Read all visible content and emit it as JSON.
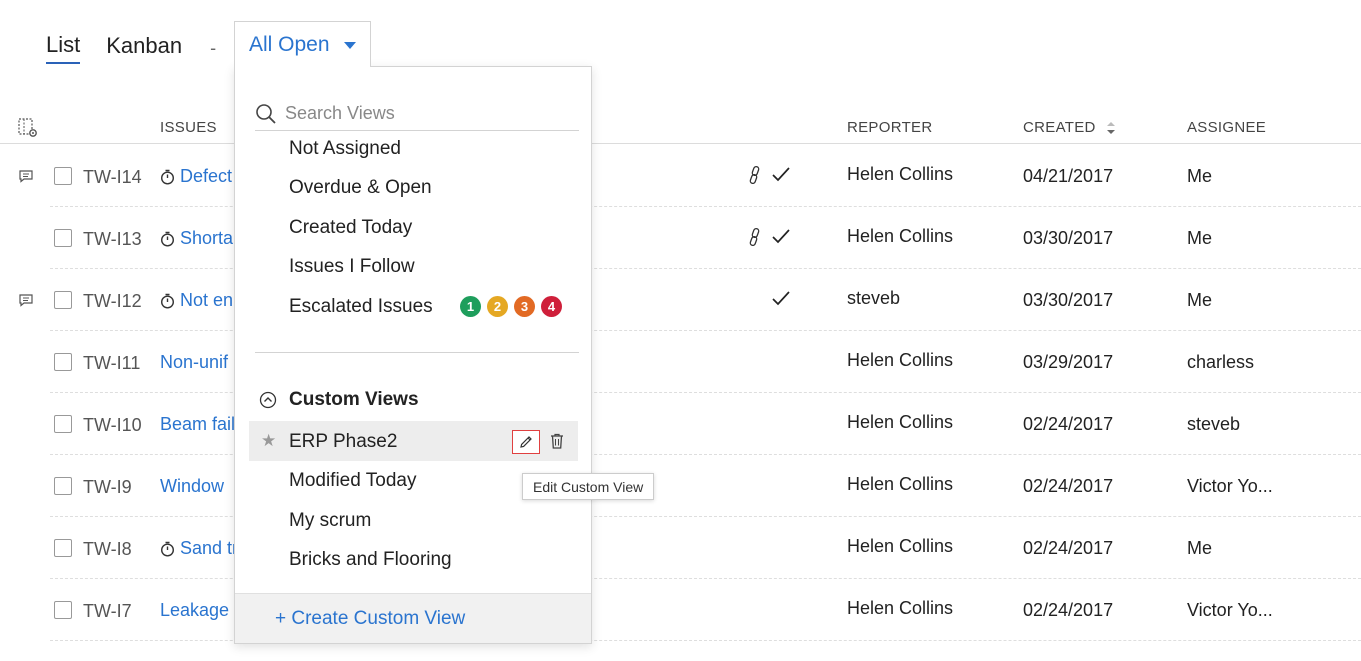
{
  "tabs": {
    "list": "List",
    "kanban": "Kanban",
    "separator": "-"
  },
  "view_selector": {
    "label": "All Open"
  },
  "header": {
    "issues": "ISSUES",
    "reporter": "REPORTER",
    "created": "CREATED",
    "assignee": "ASSIGNEE"
  },
  "rows": [
    {
      "id": "TW-I14",
      "title": "Defect",
      "timer": true,
      "comment": true,
      "link": true,
      "check": true,
      "reporter": "Helen Collins",
      "created": "04/21/2017",
      "assignee": "Me"
    },
    {
      "id": "TW-I13",
      "title": "Shorta",
      "timer": true,
      "comment": false,
      "link": true,
      "check": true,
      "reporter": "Helen Collins",
      "created": "03/30/2017",
      "assignee": "Me"
    },
    {
      "id": "TW-I12",
      "title": "Not en",
      "timer": true,
      "comment": true,
      "link": false,
      "check": true,
      "reporter": "steveb",
      "created": "03/30/2017",
      "assignee": "Me"
    },
    {
      "id": "TW-I11",
      "title": "Non-unif",
      "timer": false,
      "comment": false,
      "link": false,
      "check": false,
      "reporter": "Helen Collins",
      "created": "03/29/2017",
      "assignee": "charless"
    },
    {
      "id": "TW-I10",
      "title": "Beam fail",
      "timer": false,
      "comment": false,
      "link": false,
      "check": false,
      "reporter": "Helen Collins",
      "created": "02/24/2017",
      "assignee": "steveb"
    },
    {
      "id": "TW-I9",
      "title": "Window",
      "timer": false,
      "comment": false,
      "link": false,
      "check": false,
      "reporter": "Helen Collins",
      "created": "02/24/2017",
      "assignee": "Victor Yo..."
    },
    {
      "id": "TW-I8",
      "title": "Sand tr",
      "timer": true,
      "comment": false,
      "link": false,
      "check": false,
      "reporter": "Helen Collins",
      "created": "02/24/2017",
      "assignee": "Me"
    },
    {
      "id": "TW-I7",
      "title": "Leakage i",
      "timer": false,
      "comment": false,
      "link": false,
      "check": false,
      "reporter": "Helen Collins",
      "created": "02/24/2017",
      "assignee": "Victor Yo..."
    }
  ],
  "dropdown": {
    "search_placeholder": "Search Views",
    "items": [
      "Not Assigned",
      "Overdue & Open",
      "Created Today",
      "Issues I Follow",
      "Escalated Issues"
    ],
    "escalation_badges": [
      {
        "label": "1",
        "color": "#1e9e5c"
      },
      {
        "label": "2",
        "color": "#e5a823"
      },
      {
        "label": "3",
        "color": "#e26a24"
      },
      {
        "label": "4",
        "color": "#cf1f3a"
      }
    ],
    "custom_views_label": "Custom Views",
    "custom_views": [
      "ERP Phase2",
      "Modified Today",
      "My scrum",
      "Bricks and Flooring"
    ],
    "tooltip": "Edit Custom View",
    "create_label": "+ Create Custom View"
  },
  "colors": {
    "link": "#2a74cf",
    "active_tab_underline": "#2a62b8",
    "edit_highlight": "#e04040"
  }
}
